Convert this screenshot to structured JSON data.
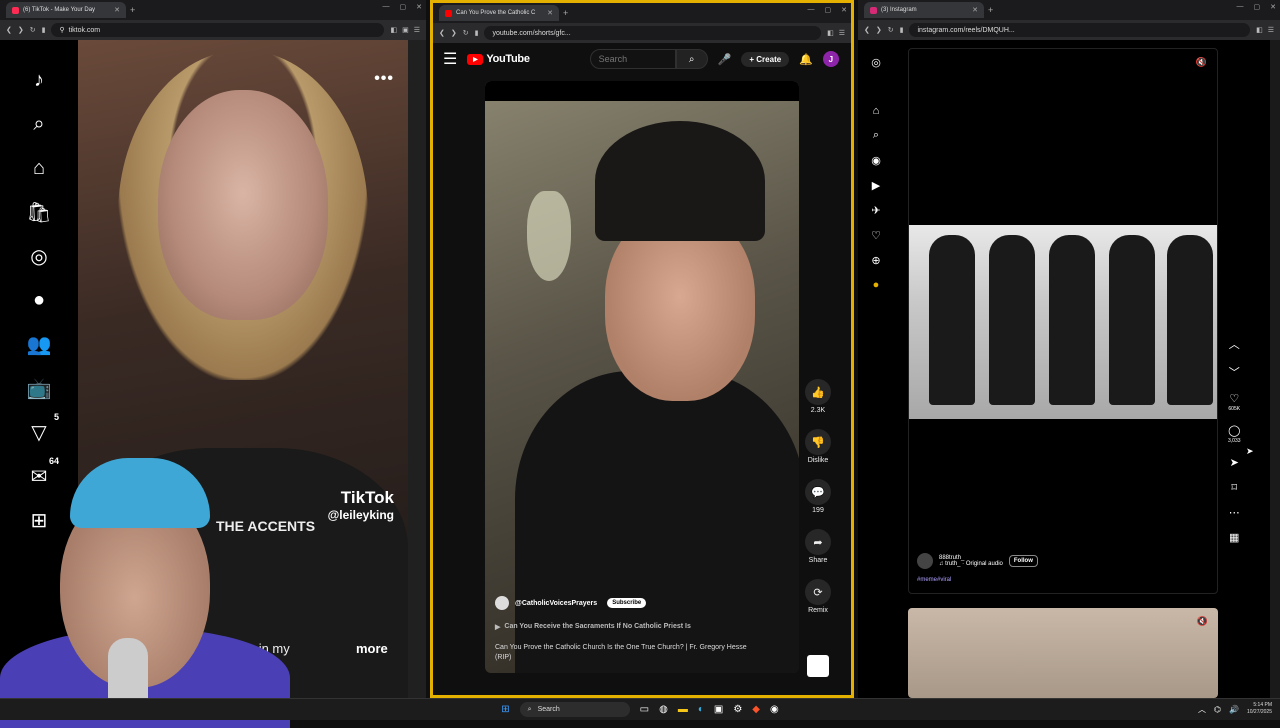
{
  "tiktok": {
    "tab_title": "(6) TikTok - Make Your Day",
    "url": "tiktok.com",
    "sidebar": {
      "inbox_badge": "5",
      "messages_badge": "64"
    },
    "video": {
      "more_menu": "•••",
      "watermark_logo": "TikTok",
      "watermark_handle": "@leileyking",
      "overlay_text": "THE ACCENTS",
      "caption": "video in my",
      "more_label": "more"
    }
  },
  "youtube": {
    "tab_title": "Can You Prove the Catholic C",
    "url": "youtube.com/shorts/gfc...",
    "logo_text": "YouTube",
    "search_placeholder": "Search",
    "create_label": "Create",
    "avatar_letter": "J",
    "actions": {
      "likes": "2.3K",
      "dislike_label": "Dislike",
      "comments": "199",
      "share_label": "Share",
      "remix_label": "Remix"
    },
    "channel": "@CatholicVoicesPrayers",
    "subscribe_label": "Subscribe",
    "related": "Can You Receive the Sacraments If No Catholic Priest Is",
    "title": "Can You Prove the Catholic Church Is the One True Church? | Fr. Gregory Hesse (RIP)"
  },
  "instagram": {
    "tab_title": "(3) Instagram",
    "url": "instagram.com/reels/DMQUH...",
    "username": "888truth_",
    "audio": "♫ truth_ · Original audio",
    "follow_label": "Follow",
    "hashtags": "#meme#viral",
    "likes": "605K",
    "comments": "3,033"
  },
  "taskbar": {
    "search_label": "Search",
    "time": "5:14 PM",
    "date": "10/27/2025"
  },
  "colors": {
    "youtube_frame": "#e5b100",
    "youtube_red": "#ff0000"
  }
}
